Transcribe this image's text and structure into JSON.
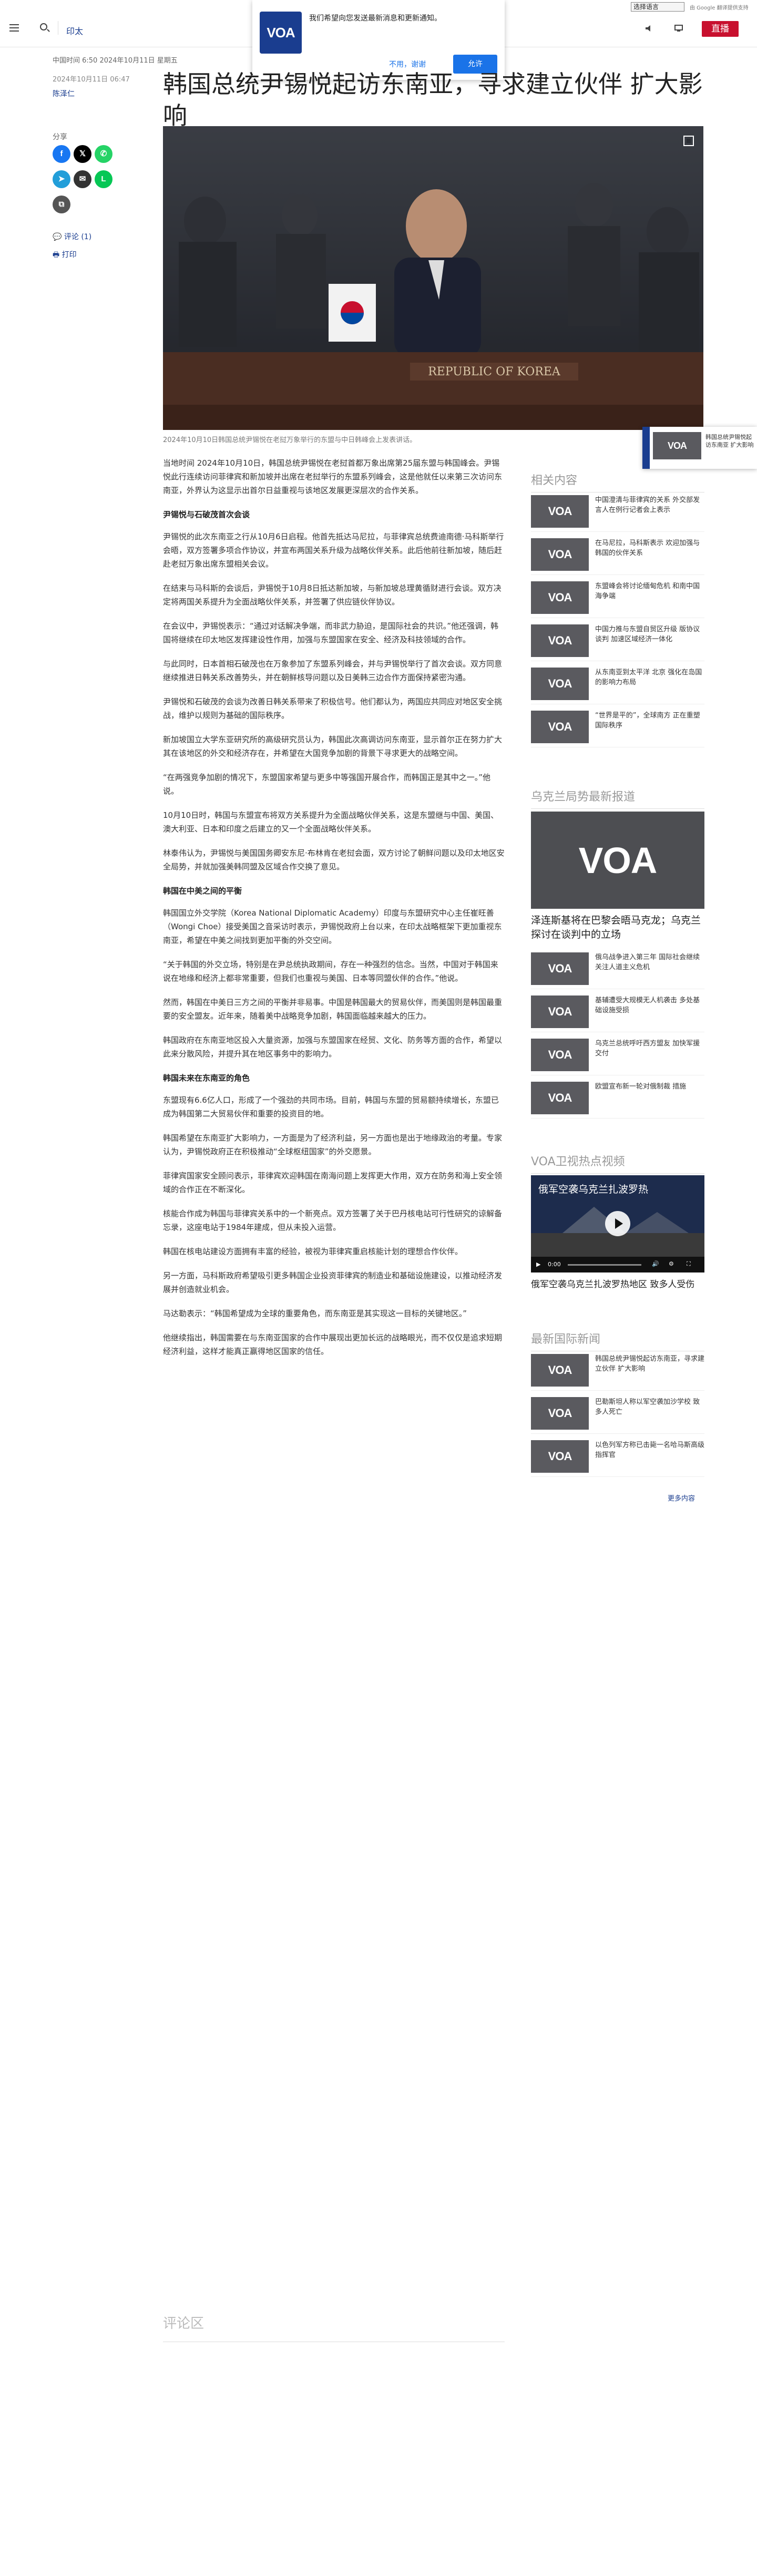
{
  "header": {
    "section_label": "印太",
    "live_label": "直播",
    "language_select": "选择语言",
    "powered_by": "由 Google 翻译提供支持"
  },
  "notification": {
    "message": "我们希望向您发送最新消息和更新通知。",
    "decline_label": "不用，谢谢",
    "accept_label": "允许",
    "logo_text": "VOA"
  },
  "article": {
    "breadcrumb": "中国时间 6:50 2024年10月11日 星期五",
    "date": "2024年10月11日 06:47",
    "author": "陈泽仁",
    "headline": "韩国总统尹锡悦起访东南亚，寻求建立伙伴 扩大影响",
    "hero_caption": "2024年10月10日韩国总统尹锡悦在老挝万象举行的东盟与中日韩峰会上发表讲话。",
    "paragraphs": [
      {
        "type": "p",
        "text": "当地时间 2024年10月10日，韩国总统尹锡悦在老挝首都万象出席第25届东盟与韩国峰会。尹锡悦此行连续访问菲律宾和新加坡并出席在老挝举行的东盟系列峰会，这是他就任以来第三次访问东南亚，外界认为这显示出首尔日益重视与该地区发展更深层次的合作关系。"
      },
      {
        "type": "h3",
        "text": "尹锡悦与石破茂首次会谈"
      },
      {
        "type": "p",
        "text": "尹锡悦的此次东南亚之行从10月6日启程。他首先抵达马尼拉，与菲律宾总统费迪南德·马科斯举行会晤，双方签署多项合作协议，并宣布两国关系升级为战略伙伴关系。此后他前往新加坡，随后赶赴老挝万象出席东盟相关会议。"
      },
      {
        "type": "p",
        "text": "在结束与马科斯的会谈后，尹锡悦于10月8日抵达新加坡，与新加坡总理黄循财进行会谈。双方决定将两国关系提升为全面战略伙伴关系，并签署了供应链伙伴协议。"
      },
      {
        "type": "p",
        "text": "在会议中，尹锡悦表示：“通过对话解决争端，而非武力胁迫，是国际社会的共识。”他还强调，韩国将继续在印太地区发挥建设性作用，加强与东盟国家在安全、经济及科技领域的合作。"
      },
      {
        "type": "p",
        "text": "与此同时，日本首相石破茂也在万象参加了东盟系列峰会，并与尹锡悦举行了首次会谈。双方同意继续推进日韩关系改善势头，并在朝鲜核导问题以及日美韩三边合作方面保持紧密沟通。"
      },
      {
        "type": "p",
        "text": "尹锡悦和石破茂的会谈为改善日韩关系带来了积极信号。他们都认为，两国应共同应对地区安全挑战，维护以规则为基础的国际秩序。"
      },
      {
        "type": "p",
        "text": "新加坡国立大学东亚研究所的高级研究员认为，韩国此次高调访问东南亚，显示首尔正在努力扩大其在该地区的外交和经济存在，并希望在大国竞争加剧的背景下寻求更大的战略空间。"
      },
      {
        "type": "p",
        "text": "“在两强竞争加剧的情况下，东盟国家希望与更多中等强国开展合作，而韩国正是其中之一。”他说。"
      },
      {
        "type": "p",
        "text": "10月10日时，韩国与东盟宣布将双方关系提升为全面战略伙伴关系，这是东盟继与中国、美国、澳大利亚、日本和印度之后建立的又一个全面战略伙伴关系。"
      },
      {
        "type": "p",
        "text": "林泰伟认为，尹锡悦与美国国务卿安东尼·布林肯在老挝会面，双方讨论了朝鲜问题以及印太地区安全局势，并就加强美韩同盟及区域合作交换了意见。"
      },
      {
        "type": "h3",
        "text": "韩国在中美之间的平衡"
      },
      {
        "type": "p",
        "text": "韩国国立外交学院（Korea National Diplomatic Academy）印度与东盟研究中心主任崔旺善（Wongi Choe）接受美国之音采访时表示，尹锡悦政府上台以来，在印太战略框架下更加重视东南亚，希望在中美之间找到更加平衡的外交空间。"
      },
      {
        "type": "p",
        "text": "“关于韩国的外交立场，特别是在尹总统执政期间，存在一种强烈的信念。当然，中国对于韩国来说在地缘和经济上都非常重要，但我们也重视与美国、日本等同盟伙伴的合作。”他说。"
      },
      {
        "type": "p",
        "text": "然而，韩国在中美日三方之间的平衡并非易事。中国是韩国最大的贸易伙伴，而美国则是韩国最重要的安全盟友。近年来，随着美中战略竞争加剧，韩国面临越来越大的压力。"
      },
      {
        "type": "p",
        "text": "韩国政府在东南亚地区投入大量资源，加强与东盟国家在经贸、文化、防务等方面的合作，希望以此来分散风险，并提升其在地区事务中的影响力。"
      },
      {
        "type": "h3",
        "text": "韩国未来在东南亚的角色"
      },
      {
        "type": "p",
        "text": "东盟现有6.6亿人口，形成了一个强劲的共同市场。目前，韩国与东盟的贸易额持续增长，东盟已成为韩国第二大贸易伙伴和重要的投资目的地。"
      },
      {
        "type": "p",
        "text": "韩国希望在东南亚扩大影响力，一方面是为了经济利益，另一方面也是出于地缘政治的考量。专家认为，尹锡悦政府正在积极推动“全球枢纽国家”的外交愿景。"
      },
      {
        "type": "p",
        "text": "菲律宾国家安全顾问表示，菲律宾欢迎韩国在南海问题上发挥更大作用，双方在防务和海上安全领域的合作正在不断深化。"
      },
      {
        "type": "p",
        "text": "核能合作成为韩国与菲律宾关系中的一个新亮点。双方签署了关于巴丹核电站可行性研究的谅解备忘录，这座电站于1984年建成，但从未投入运营。"
      },
      {
        "type": "p",
        "text": "韩国在核电站建设方面拥有丰富的经验，被视为菲律宾重启核能计划的理想合作伙伴。"
      },
      {
        "type": "p",
        "text": "另一方面，马科斯政府希望吸引更多韩国企业投资菲律宾的制造业和基础设施建设，以推动经济发展并创造就业机会。"
      },
      {
        "type": "p",
        "text": "马达勒表示：“韩国希望成为全球的重要角色，而东南亚是其实现这一目标的关键地区。”"
      },
      {
        "type": "p",
        "text": "他继续指出，韩国需要在与东南亚国家的合作中展现出更加长远的战略眼光，而不仅仅是追求短期经济利益，这样才能真正赢得地区国家的信任。"
      }
    ],
    "comments_heading": "评论区"
  },
  "share": {
    "label": "分享",
    "comments_link": "评论 (1)",
    "print_link": "打印",
    "buttons": [
      {
        "name": "facebook",
        "glyph": "f",
        "color": "#1877f2"
      },
      {
        "name": "twitter",
        "glyph": "𝕏",
        "color": "#000000"
      },
      {
        "name": "whatsapp",
        "glyph": "✆",
        "color": "#25d366"
      },
      {
        "name": "telegram",
        "glyph": "➤",
        "color": "#229ed9"
      },
      {
        "name": "email",
        "glyph": "✉",
        "color": "#333333"
      },
      {
        "name": "line",
        "glyph": "L",
        "color": "#06c755"
      },
      {
        "name": "copy-link",
        "glyph": "⧉",
        "color": "#555555"
      }
    ]
  },
  "sidebar": {
    "related_title": "相关内容",
    "related": [
      {
        "text": "中国澄清与菲律宾的关系 外交部发言人在例行记者会上表示"
      },
      {
        "text": "在马尼拉，马科斯表示 欢迎加强与韩国的伙伴关系"
      },
      {
        "text": "东盟峰会将讨论缅甸危机 和南中国海争端"
      },
      {
        "text": "中国力推与东盟自贸区升级 版协议谈判 加速区域经济一体化"
      },
      {
        "text": "从东南亚到太平洋 北京 强化在岛国的影响力布局"
      },
      {
        "text": "“世界是平的”，全球南方 正在重塑国际秩序"
      }
    ],
    "ukraine_title": "乌克兰局势最新报道",
    "ukraine_feature": "泽连斯基将在巴黎会晤马克龙；乌克兰探讨在谈判中的立场",
    "ukraine": [
      {
        "text": "俄乌战争进入第三年 国际社会继续关注人道主义危机"
      },
      {
        "text": "基辅遭受大规模无人机袭击 多处基础设施受损"
      },
      {
        "text": "乌克兰总统呼吁西方盟友 加快军援交付"
      },
      {
        "text": "欧盟宣布新一轮对俄制裁 措施"
      }
    ],
    "video_title": "VOA卫视热点视频",
    "video_overlay": "俄军空袭乌克兰扎波罗热",
    "video_time": "0:00",
    "video_caption": "俄军空袭乌克兰扎波罗热地区 致多人受伤",
    "intl_title": "最新国际新闻",
    "intl": [
      {
        "text": "韩国总统尹锡悦起访东南亚，寻求建立伙伴 扩大影响"
      },
      {
        "text": "巴勒斯坦人称以军空袭加沙学校 致多人死亡"
      },
      {
        "text": "以色列军方称已击毙一名哈马斯高级指挥官"
      }
    ],
    "more_label": "更多内容"
  },
  "floating": {
    "text": "韩国总统尹锡悦起访东南亚 扩大影响"
  },
  "hero_image": {
    "podium_text": "REPUBLIC OF KOREA"
  },
  "colors": {
    "brand_blue": "#1a3d8f",
    "live_red": "#c8102e",
    "link_blue": "#1a73e8"
  }
}
